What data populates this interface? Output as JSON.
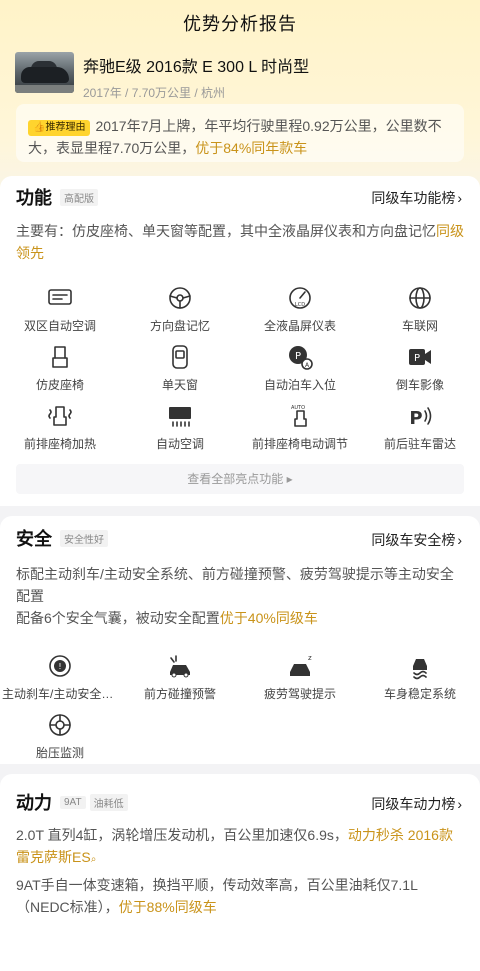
{
  "header": {
    "title": "优势分析报告"
  },
  "car": {
    "name": "奔驰E级 2016款 E 300 L 时尚型",
    "meta": "2017年 / 7.70万公里 / 杭州"
  },
  "reason": {
    "tag": "推荐理由",
    "text": "2017年7月上牌，年平均行驶里程0.92万公里，公里数不大，表显里程7.70万公里，",
    "highlight": "优于84%同年款车"
  },
  "features": {
    "title": "功能",
    "badge": "高配版",
    "link": "同级车功能榜",
    "desc": "主要有：仿皮座椅、单天窗等配置，其中全液晶屏仪表和方向盘记忆",
    "desc_highlight": "同级领先",
    "items": [
      {
        "label": "双区自动空调",
        "icon": "dual-zone-ac-icon"
      },
      {
        "label": "方向盘记忆",
        "icon": "steering-wheel-memory-icon"
      },
      {
        "label": "全液晶屏仪表",
        "icon": "lcd-dashboard-icon"
      },
      {
        "label": "车联网",
        "icon": "connected-car-icon"
      },
      {
        "label": "仿皮座椅",
        "icon": "leather-seat-icon"
      },
      {
        "label": "单天窗",
        "icon": "sunroof-icon"
      },
      {
        "label": "自动泊车入位",
        "icon": "auto-parking-icon"
      },
      {
        "label": "倒车影像",
        "icon": "rear-camera-icon"
      },
      {
        "label": "前排座椅加热",
        "icon": "seat-heating-icon"
      },
      {
        "label": "自动空调",
        "icon": "auto-ac-icon"
      },
      {
        "label": "前排座椅电动调节",
        "icon": "power-seat-icon"
      },
      {
        "label": "前后驻车雷达",
        "icon": "parking-radar-icon"
      }
    ],
    "see_all": "查看全部亮点功能"
  },
  "safety": {
    "title": "安全",
    "badge": "安全性好",
    "link": "同级车安全榜",
    "desc1": "标配主动刹车/主动安全系统、前方碰撞预警、疲劳驾驶提示等主动安全配置",
    "desc2": "配备6个安全气囊，被动安全配置",
    "desc2_highlight": "优于40%同级车",
    "items": [
      {
        "label": "主动刹车/主动安全系统",
        "icon": "active-brake-icon"
      },
      {
        "label": "前方碰撞预警",
        "icon": "collision-warning-icon"
      },
      {
        "label": "疲劳驾驶提示",
        "icon": "fatigue-warning-icon"
      },
      {
        "label": "车身稳定系统",
        "icon": "stability-control-icon"
      },
      {
        "label": "胎压监测",
        "icon": "tire-pressure-icon"
      }
    ]
  },
  "power": {
    "title": "动力",
    "badge1": "9AT",
    "badge2": "油耗低",
    "link": "同级车动力榜",
    "desc1": "2.0T 直列4缸，涡轮增压发动机，百公里加速仅6.9s，",
    "desc1_highlight": "动力秒杀 2016款雷克萨斯ES",
    "desc2": "9AT手自一体变速箱，换挡平顺，传动效率高，百公里油耗仅7.1L（NEDC标准），",
    "desc2_highlight": "优于88%同级车"
  },
  "colors": {
    "accent": "#c9931a",
    "tag": "#ffd42e",
    "hero": "#fff3c8"
  }
}
